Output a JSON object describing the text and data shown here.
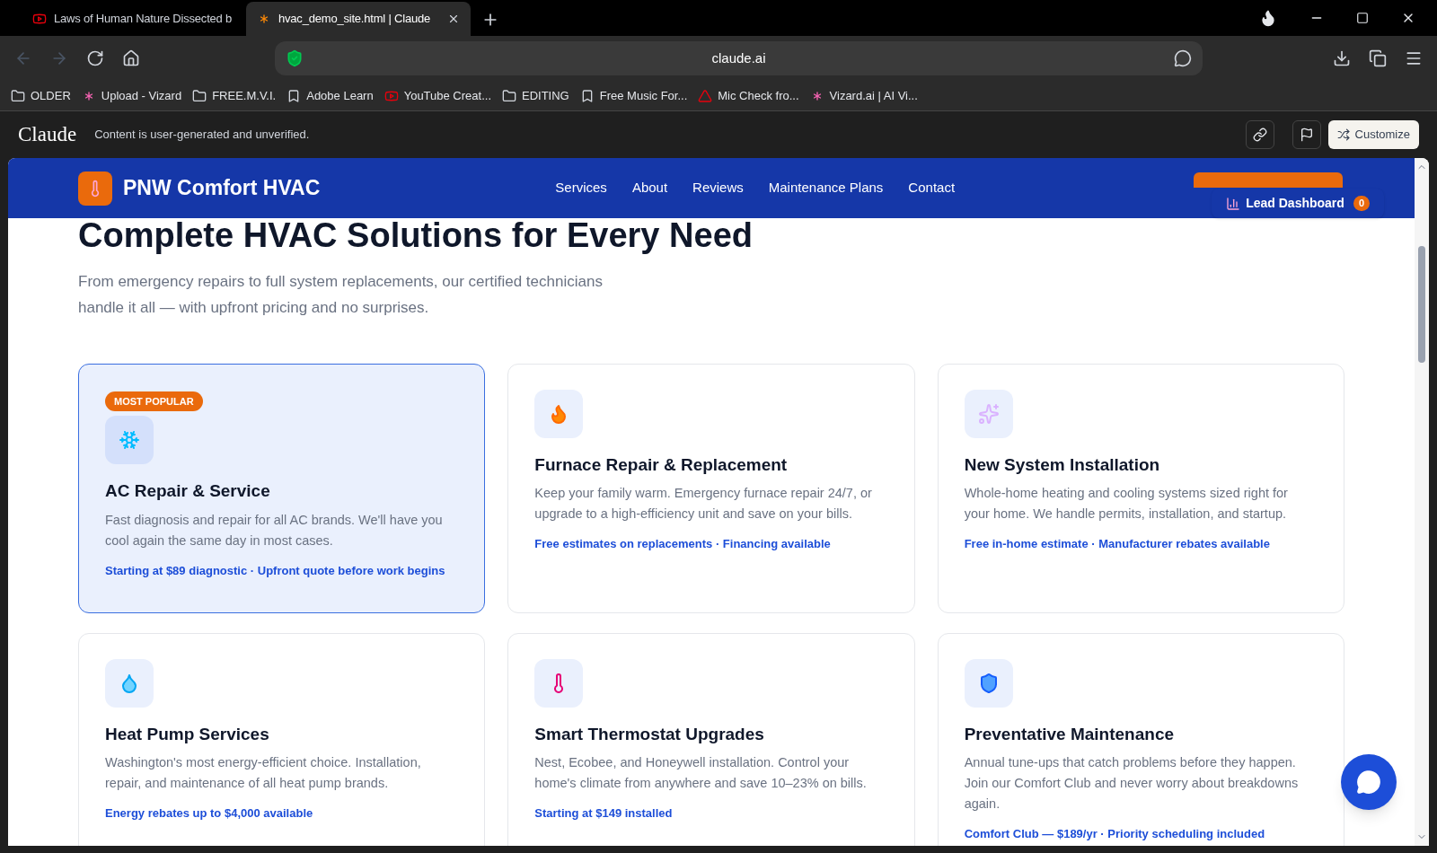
{
  "browser": {
    "tabs": [
      {
        "title": "Laws of Human Nature Dissected b",
        "selected": false
      },
      {
        "title": "hvac_demo_site.html | Claude",
        "selected": true
      }
    ],
    "url": "claude.ai",
    "bookmarks": [
      "OLDER",
      "Upload - Vizard",
      "FREE.M.V.I.",
      "Adobe Learn",
      "YouTube Creat...",
      "EDITING",
      "Free Music For...",
      "Mic Check fro...",
      "Vizard.ai | AI Vi..."
    ]
  },
  "artifact_bar": {
    "brand": "Claude",
    "notice": "Content is user-generated and unverified.",
    "customize": "Customize"
  },
  "site": {
    "brand": "PNW Comfort HVAC",
    "nav": [
      "Services",
      "About",
      "Reviews",
      "Maintenance Plans",
      "Contact"
    ],
    "lead_dashboard": {
      "label": "Lead Dashboard",
      "count": "0"
    },
    "heading": "Complete HVAC Solutions for Every Need",
    "intro": "From emergency repairs to full system replacements, our certified technicians handle it all — with upfront pricing and no surprises.",
    "services": [
      {
        "featured": true,
        "badge": "MOST POPULAR",
        "title": "AC Repair & Service",
        "text": "Fast diagnosis and repair for all AC brands. We'll have you cool again the same day in most cases.",
        "note": "Starting at $89 diagnostic · Upfront quote before work begins"
      },
      {
        "featured": false,
        "title": "Furnace Repair & Replacement",
        "text": "Keep your family warm. Emergency furnace repair 24/7, or upgrade to a high-efficiency unit and save on your bills.",
        "note": "Free estimates on replacements · Financing available"
      },
      {
        "featured": false,
        "title": "New System Installation",
        "text": "Whole-home heating and cooling systems sized right for your home. We handle permits, installation, and startup.",
        "note": "Free in-home estimate · Manufacturer rebates available"
      },
      {
        "featured": false,
        "title": "Heat Pump Services",
        "text": "Washington's most energy-efficient choice. Installation, repair, and maintenance of all heat pump brands.",
        "note": "Energy rebates up to $4,000 available"
      },
      {
        "featured": false,
        "title": "Smart Thermostat Upgrades",
        "text": "Nest, Ecobee, and Honeywell installation. Control your home's climate from anywhere and save 10–23% on bills.",
        "note": "Starting at $149 installed"
      },
      {
        "featured": false,
        "title": "Preventative Maintenance",
        "text": "Annual tune-ups that catch problems before they happen. Join our Comfort Club and never worry about breakdowns again.",
        "note": "Comfort Club — $189/yr · Priority scheduling included"
      }
    ]
  }
}
